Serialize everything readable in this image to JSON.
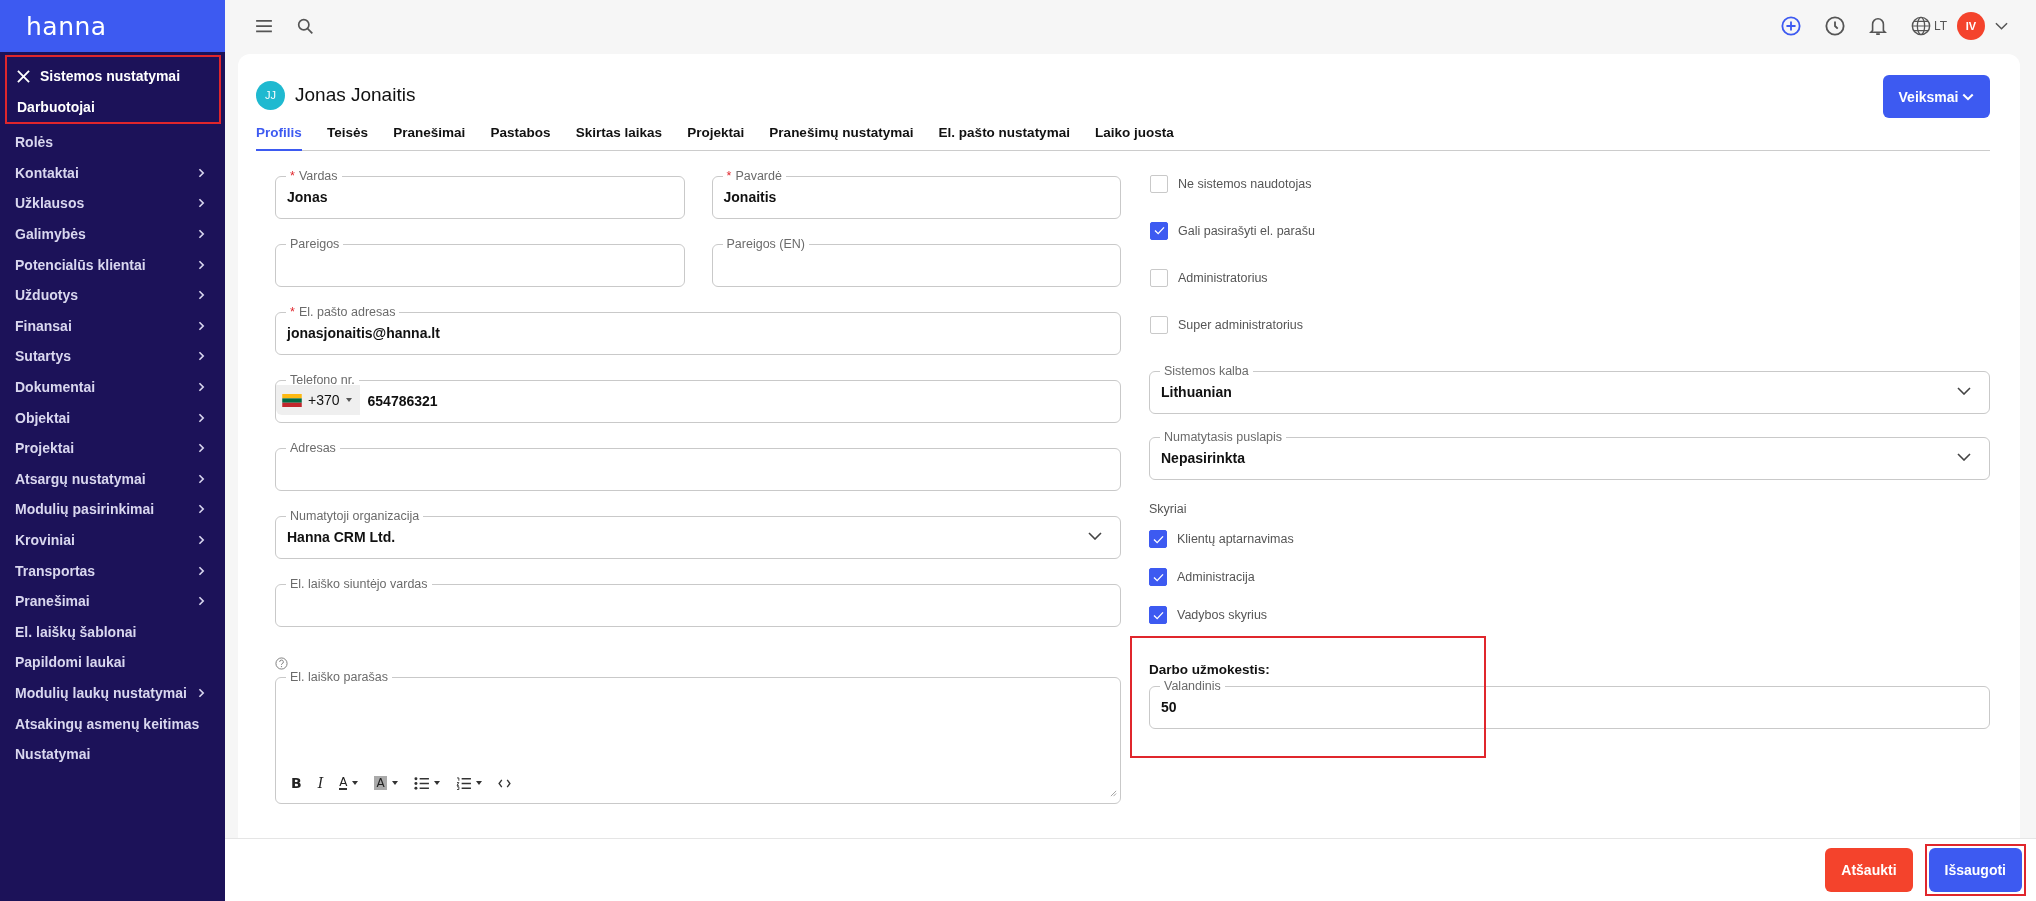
{
  "sidebar": {
    "logo": "hanna",
    "section": {
      "title": "Sistemos nustatymai",
      "current": "Darbuotojai",
      "highlighted": true
    },
    "items": [
      {
        "label": "Rolės",
        "submenu": false
      },
      {
        "label": "Kontaktai",
        "submenu": true
      },
      {
        "label": "Užklausos",
        "submenu": true
      },
      {
        "label": "Galimybės",
        "submenu": true
      },
      {
        "label": "Potencialūs klientai",
        "submenu": true
      },
      {
        "label": "Užduotys",
        "submenu": true
      },
      {
        "label": "Finansai",
        "submenu": true
      },
      {
        "label": "Sutartys",
        "submenu": true
      },
      {
        "label": "Dokumentai",
        "submenu": true
      },
      {
        "label": "Objektai",
        "submenu": true
      },
      {
        "label": "Projektai",
        "submenu": true
      },
      {
        "label": "Atsargų nustatymai",
        "submenu": true
      },
      {
        "label": "Modulių pasirinkimai",
        "submenu": true
      },
      {
        "label": "Kroviniai",
        "submenu": true
      },
      {
        "label": "Transportas",
        "submenu": true
      },
      {
        "label": "Pranešimai",
        "submenu": true
      },
      {
        "label": "El. laiškų šablonai",
        "submenu": false
      },
      {
        "label": "Papildomi laukai",
        "submenu": false
      },
      {
        "label": "Modulių laukų nustatymai",
        "submenu": true
      },
      {
        "label": "Atsakingų asmenų keitimas",
        "submenu": false
      },
      {
        "label": "Nustatymai",
        "submenu": false
      }
    ]
  },
  "topbar": {
    "language": "LT",
    "user_initials": "IV"
  },
  "header": {
    "avatar_initials": "JJ",
    "name": "Jonas Jonaitis",
    "actions_button": "Veiksmai"
  },
  "tabs": [
    {
      "label": "Profilis",
      "selected": true
    },
    {
      "label": "Teisės",
      "selected": false
    },
    {
      "label": "Pranešimai",
      "selected": false
    },
    {
      "label": "Pastabos",
      "selected": false
    },
    {
      "label": "Skirtas laikas",
      "selected": false
    },
    {
      "label": "Projektai",
      "selected": false
    },
    {
      "label": "Pranešimų nustatymai",
      "selected": false
    },
    {
      "label": "El. pašto nustatymai",
      "selected": false
    },
    {
      "label": "Laiko juosta",
      "selected": false
    }
  ],
  "left_fields": [
    {
      "kind": "pair",
      "fields": [
        {
          "label": "Vardas",
          "required_mark": "*",
          "value": "Jonas"
        },
        {
          "label": "Pavardė",
          "required_mark": "*",
          "value": "Jonaitis"
        }
      ]
    },
    {
      "kind": "pair",
      "fields": [
        {
          "label": "Pareigos"
        },
        {
          "label": "Pareigos (EN)"
        }
      ]
    },
    {
      "kind": "text",
      "label": "El. pašto adresas",
      "required_mark": "*",
      "value": "jonasjonaitis@hanna.lt"
    },
    {
      "kind": "phone",
      "label": "Telefono nr.",
      "country_code": "+370",
      "value": "654786321"
    },
    {
      "kind": "text",
      "label": "Adresas"
    },
    {
      "kind": "select",
      "label": "Numatytoji organizacija",
      "value": "Hanna CRM Ltd."
    },
    {
      "kind": "text",
      "label": "El. laiško siuntėjo vardas"
    },
    {
      "kind": "editor",
      "label": "El. laiško parašas",
      "toolbar": [
        {
          "kind": "bold",
          "glyph": "B",
          "dropdown": false
        },
        {
          "kind": "italic",
          "glyph": "I",
          "dropdown": false
        },
        {
          "kind": "text-color",
          "glyph": "A",
          "dropdown": true
        },
        {
          "kind": "highlight",
          "glyph": "A",
          "dropdown": true
        },
        {
          "kind": "bullet-list",
          "dropdown": true
        },
        {
          "kind": "numbered-list",
          "dropdown": true
        },
        {
          "kind": "code",
          "dropdown": false
        }
      ]
    }
  ],
  "checkboxes": [
    {
      "label": "Ne sistemos naudotojas",
      "checked": false
    },
    {
      "label": "Gali pasirašyti el. parašu",
      "checked": true
    },
    {
      "label": "Administratorius",
      "checked": false
    },
    {
      "label": "Super administratorius",
      "checked": false
    }
  ],
  "selects": [
    {
      "label": "Sistemos kalba",
      "value": "Lithuanian"
    },
    {
      "label": "Numatytasis puslapis",
      "value": "Nepasirinkta"
    }
  ],
  "departments": {
    "label": "Skyriai",
    "items": [
      {
        "label": "Klientų aptarnavimas",
        "checked": true
      },
      {
        "label": "Administracija",
        "checked": true
      },
      {
        "label": "Vadybos skyrius",
        "checked": true
      }
    ]
  },
  "salary": {
    "title": "Darbo užmokestis:",
    "highlighted": true,
    "field": {
      "label": "Valandinis",
      "value": "50"
    }
  },
  "footer": {
    "buttons": [
      {
        "kind": "cancel",
        "label": "Atšaukti",
        "highlighted": false
      },
      {
        "kind": "save",
        "label": "Išsaugoti",
        "highlighted": true
      }
    ]
  }
}
